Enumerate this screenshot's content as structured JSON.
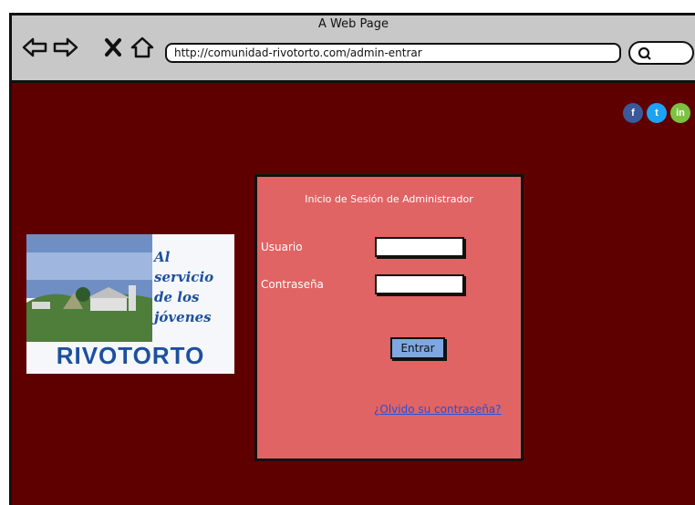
{
  "browser": {
    "title": "A Web Page",
    "url": "http://comunidad-rivotorto.com/admin-entrar"
  },
  "social": [
    {
      "icon": "facebook-icon",
      "glyph": "f",
      "color": "#3b5998"
    },
    {
      "icon": "twitter-icon",
      "glyph": "t",
      "color": "#1da1f2"
    },
    {
      "icon": "linkedin-icon",
      "glyph": "in",
      "color": "#7cc242"
    }
  ],
  "logo": {
    "tagline_1": "Al servicio",
    "tagline_2": "de los",
    "tagline_3": "jóvenes",
    "brand": "RIVOTORTO"
  },
  "login": {
    "title": "Inicio de Sesión de Administrador",
    "username_label": "Usuario",
    "username_value": "",
    "password_label": "Contraseña",
    "password_value": "",
    "submit_label": "Entrar",
    "forgot_link": "¿Olvido su contraseña?"
  },
  "colors": {
    "page_bg": "#5e0000",
    "panel_bg": "#e06464",
    "button_bg": "#7fa7e0",
    "link": "#2b4fd6",
    "brand_blue": "#1d4f9e"
  }
}
